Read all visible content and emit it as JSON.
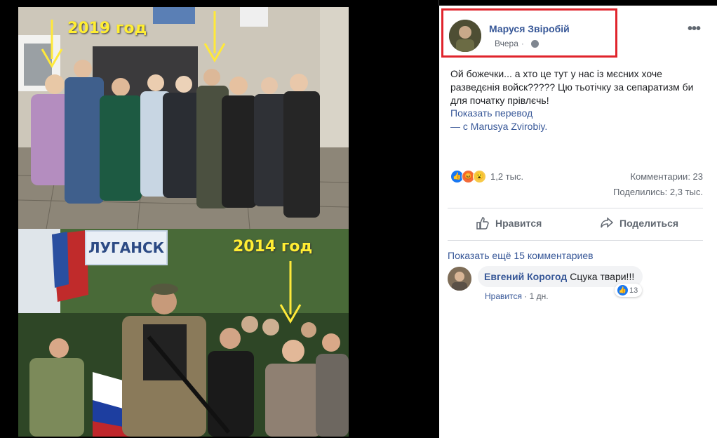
{
  "photo": {
    "caption_2019": "2019 год",
    "caption_2014": "2014 год",
    "sign": "ЛУГАНСК"
  },
  "post": {
    "author": "Маруся Звіробій",
    "time": "Вчера",
    "text": "Ой божечки... а хто це тут у нас із мєсних хоче разведєнія войск????? Цю тьотічку за сепаратизм би для початку прівлєчь!",
    "translate_label": "Показать перевод",
    "via_prefix": "— с",
    "via_name": "Marusya Zvirobiy",
    "via_suffix": ".",
    "more_icon": "more-horizontal-icon",
    "privacy_icon": "globe-icon"
  },
  "stats": {
    "reactions_count": "1,2 тыс.",
    "comments": "Комментарии: 23",
    "shares": "Поделились: 2,3 тыс.",
    "reaction_icons": [
      "like-icon",
      "angry-icon",
      "wow-icon"
    ]
  },
  "actions": {
    "like": "Нравится",
    "share": "Поделиться"
  },
  "comments": {
    "show_more": "Показать ещё 15 комментариев",
    "items": [
      {
        "author": "Евгений Корогод",
        "text": "Сцука твари!!!",
        "reaction_count": "13",
        "like_label": "Нравится",
        "time": "1 дн."
      }
    ]
  },
  "colors": {
    "link": "#385898",
    "highlight_border": "#e0242c",
    "caption": "#ffee33"
  }
}
